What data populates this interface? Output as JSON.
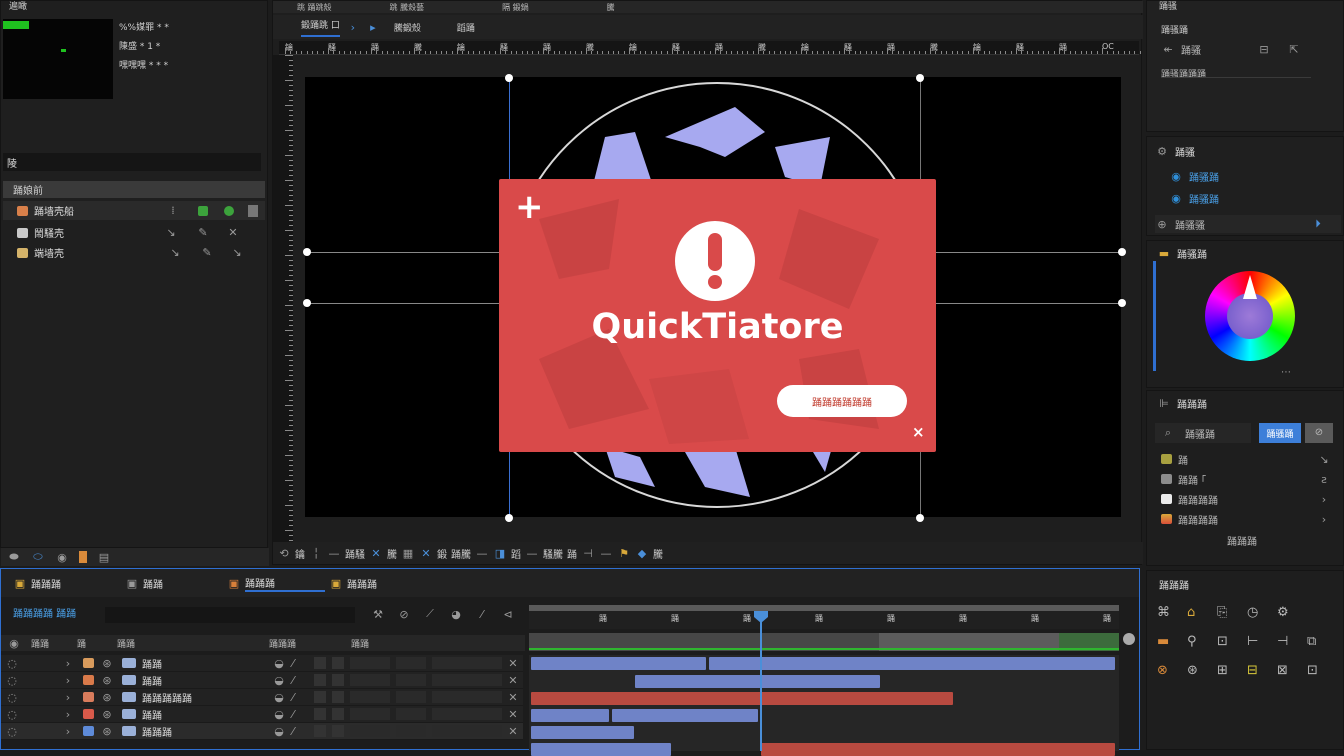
{
  "app": {
    "top_left_label": "遍瞰"
  },
  "project_panel": {
    "info_lines": [
      "%%媒罪  *  *",
      "陳盛  * 1 *",
      "嘿嘿嘿  * * *"
    ],
    "search_label": "陵",
    "list_header": "踊娘前",
    "items": [
      {
        "label": "踊墙壳船",
        "color": "#d9804a"
      },
      {
        "label": "鬧騷壳",
        "color": "#c9c9c9"
      },
      {
        "label": "端墙壳",
        "color": "#d4b36a"
      }
    ],
    "footer_icons": [
      "lock-icon",
      "link-icon",
      "eye-icon",
      "chart-icon"
    ]
  },
  "viewer": {
    "tabs": [
      "跳 踊跳殼",
      "跳 騰殼藝",
      "隔 鍛鍋",
      "騰"
    ],
    "subtabs": [
      "鍛踊跳 口 ",
      "騰鍛殼 ",
      "蹈踊"
    ],
    "ruler_labels": [
      "鑰",
      "騷",
      "踊",
      "騰",
      "鑰",
      "騷",
      "踊",
      "騰",
      "鑰",
      "騷",
      "踊",
      "騰",
      "鑰",
      "騷",
      "踊",
      "騰",
      "鑰",
      "騷",
      "踊",
      "OC"
    ],
    "bottom_toolbar": [
      "鑰 ",
      "踊騷 ",
      "騰",
      "鍛 ",
      "踊騰 ",
      "蹈 ",
      "騷騰 ",
      "踊 ",
      "騰 "
    ]
  },
  "dialog": {
    "title": "QuickTiatore",
    "button_label": "踊踊踊踊踊踊",
    "bg_color": "#d94a4a",
    "plus": "+",
    "close": "×"
  },
  "properties_panel": {
    "title": "踊骚",
    "subtitle": "踊骚踊",
    "row1": "踊骚",
    "row2": "踊骚踊踊踊",
    "section2": "踊骚",
    "section2_items": [
      "踊骚踊",
      "踊骚踊"
    ],
    "section3": "踊骚骚",
    "section4": "踊骚踊"
  },
  "color_panel": {
    "title": "踊骚踊"
  },
  "effects_panel": {
    "title": "踊踊踊",
    "search_placeholder": "踊骚踊",
    "btn1": "踊骚踊",
    "items": [
      "踊",
      "踊踊 ｢ ",
      "踊踊踊踊",
      "踊踊踊踊 "
    ],
    "footer": "踊踊踊"
  },
  "timeline": {
    "tabs": [
      "踊踊踊",
      "踊踊",
      "踊踊踊",
      "踊踊踊"
    ],
    "comp_name": "踊踊踊踊 踊踊",
    "columns": [
      "踊踊",
      "踊",
      "踊踊",
      "踊踊踊",
      "踊踊"
    ],
    "layers": [
      {
        "name": "踊踊",
        "swatch": "#d99b5c"
      },
      {
        "name": "踊踊",
        "swatch": "#d97a4a"
      },
      {
        "name": "踊踊踊踊踊",
        "swatch": "#d97c5c"
      },
      {
        "name": "踊踊",
        "swatch": "#d95a4a"
      },
      {
        "name": "踊踊踊",
        "swatch": "#5e8bd9"
      }
    ],
    "time_labels": [
      "踊",
      "踊",
      "踊",
      "踊",
      "踊",
      "踊",
      "踊",
      "踊",
      "踊"
    ]
  },
  "right_bottom_panel": {
    "title": "踊踊踊"
  },
  "colors": {
    "accent": "#2f6fd1",
    "dialog_red": "#d94a4a",
    "bar_blue": "#6f83c7",
    "bar_red": "#b84a40",
    "star": "#a7a9f0"
  }
}
